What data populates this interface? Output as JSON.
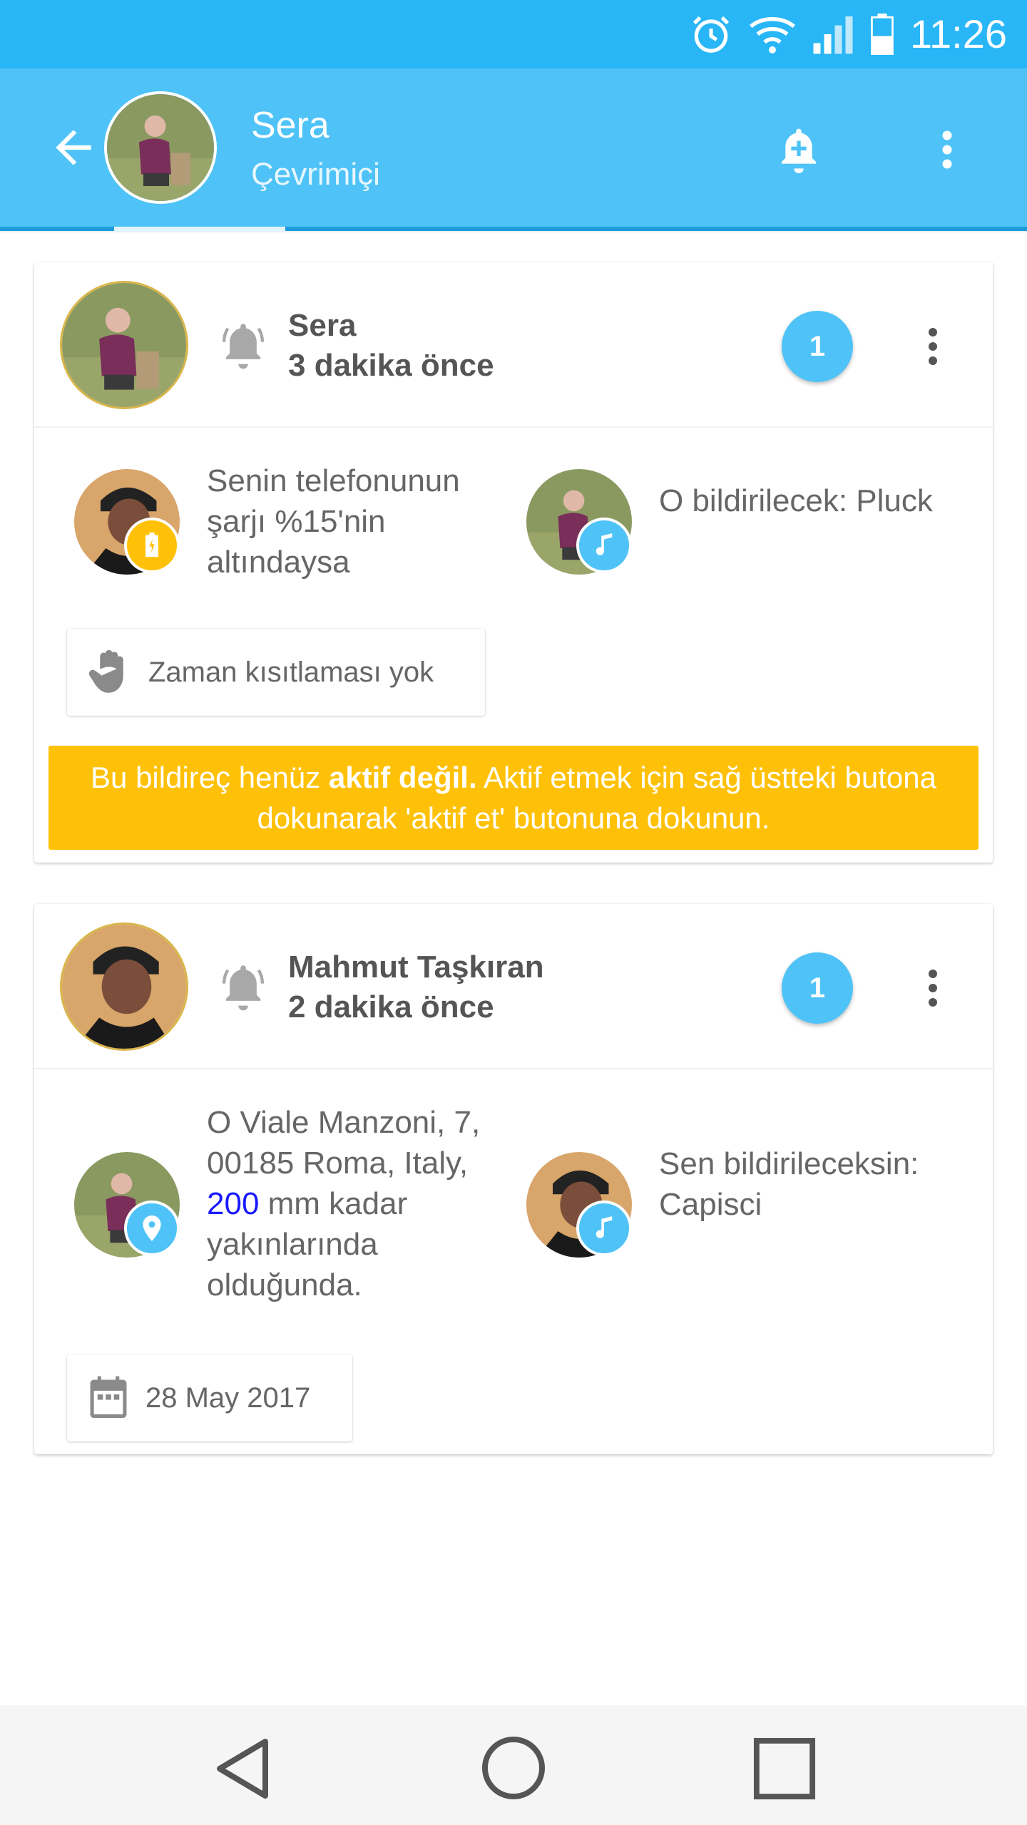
{
  "status_bar": {
    "time": "11:26"
  },
  "header": {
    "name": "Sera",
    "status": "Çevrimiçi"
  },
  "cards": [
    {
      "name": "Sera",
      "time": "3 dakika önce",
      "badge": "1",
      "condition_text": "Senin telefonunun şarjı %15'nin altındaysa",
      "condition_icon": "battery-icon",
      "action_text": "O bildirilecek: Pluck",
      "action_icon": "music-note-icon",
      "chip_text": "Zaman kısıtlaması yok",
      "chip_icon": "hand-icon",
      "warning_prefix": "Bu bildireç henüz ",
      "warning_bold": "aktif değil.",
      "warning_suffix": " Aktif etmek için sağ üstteki butona dokunarak 'aktif et' butonuna dokunun."
    },
    {
      "name": "Mahmut Taşkıran",
      "time": "2 dakika önce",
      "badge": "1",
      "condition_text_before": "O Viale Manzoni, 7, 00185 Roma, Italy, ",
      "condition_highlight": "200",
      "condition_text_after": " mm kadar yakınlarında olduğunda.",
      "condition_icon": "location-pin-icon",
      "action_text": "Sen bildirileceksin: Capisci",
      "action_icon": "music-note-icon",
      "chip_text": "28 May 2017",
      "chip_icon": "calendar-icon"
    }
  ],
  "colors": {
    "status_bar": "#29b6f6",
    "app_bar": "#4fc3f7",
    "accent": "#4fc3f7",
    "warning": "#ffc107",
    "battery_badge": "#ffc107",
    "highlight": "#1a1aff"
  }
}
